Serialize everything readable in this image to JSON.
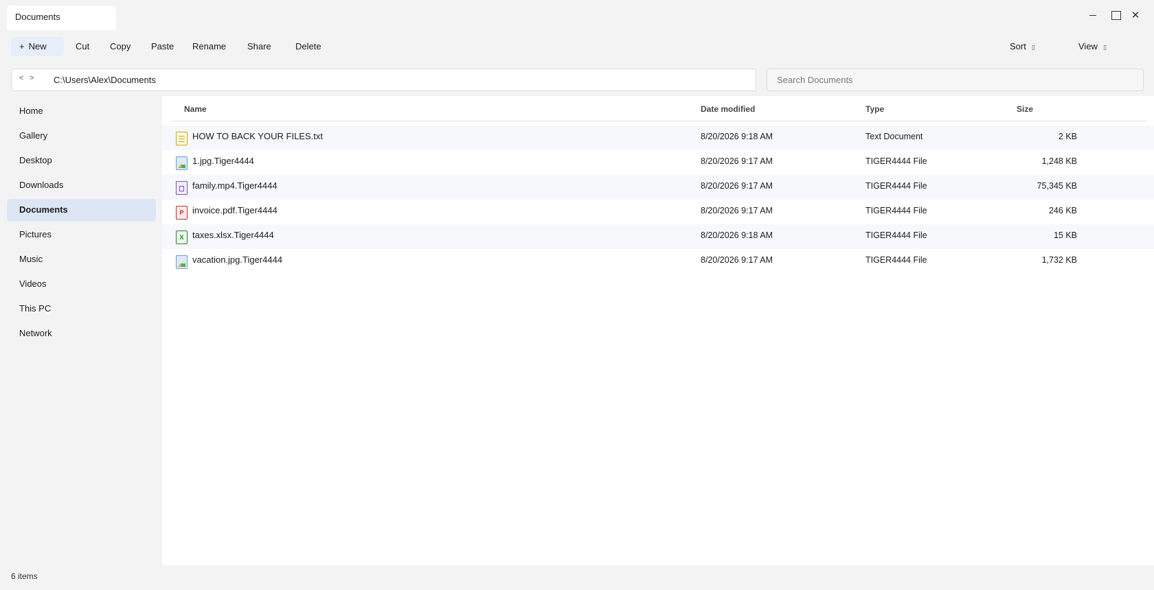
{
  "window": {
    "tab_title": "Documents",
    "controls": [
      "minimize-icon",
      "maximize-icon",
      "close-icon"
    ],
    "close_glyph": "✕"
  },
  "toolbar": {
    "new_plus": "+",
    "new_label": "New",
    "cut_label": "Cut",
    "copy_label": "Copy",
    "paste_label": "Paste",
    "rename_label": "Rename",
    "share_label": "Share",
    "delete_label": "Delete",
    "sort_label": "Sort",
    "view_label": "View",
    "chevron_glyph": "▯"
  },
  "address": {
    "back_glyph": "<",
    "forward_glyph": ">",
    "path": "C:\\Users\\Alex\\Documents"
  },
  "search": {
    "placeholder": "Search Documents",
    "value": ""
  },
  "sidebar": {
    "items": [
      {
        "label": "Home",
        "active": false
      },
      {
        "label": "Gallery",
        "active": false
      },
      {
        "label": "Desktop",
        "active": false
      },
      {
        "label": "Downloads",
        "active": false
      },
      {
        "label": "Documents",
        "active": true
      },
      {
        "label": "Pictures",
        "active": false
      },
      {
        "label": "Music",
        "active": false
      },
      {
        "label": "Videos",
        "active": false
      },
      {
        "label": "This PC",
        "active": false
      },
      {
        "label": "Network",
        "active": false
      }
    ]
  },
  "columns": {
    "name": "Name",
    "date": "Date modified",
    "type": "Type",
    "size": "Size"
  },
  "files": [
    {
      "icon": "text-file-icon",
      "name": "HOW TO BACK YOUR FILES.txt",
      "date": "8/20/2026 9:18 AM",
      "type": "Text Document",
      "size": "2 KB"
    },
    {
      "icon": "image-file-icon",
      "name": "1.jpg.Tiger4444",
      "date": "8/20/2026 9:17 AM",
      "type": "TIGER4444 File",
      "size": "1,248 KB"
    },
    {
      "icon": "video-file-icon",
      "name": "family.mp4.Tiger4444",
      "date": "8/20/2026 9:17 AM",
      "type": "TIGER4444 File",
      "size": "75,345 KB"
    },
    {
      "icon": "pdf-file-icon",
      "icon_letter": "P",
      "name": "invoice.pdf.Tiger4444",
      "date": "8/20/2026 9:17 AM",
      "type": "TIGER4444 File",
      "size": "246 KB"
    },
    {
      "icon": "excel-file-icon",
      "icon_letter": "X",
      "name": "taxes.xlsx.Tiger4444",
      "date": "8/20/2026 9:18 AM",
      "type": "TIGER4444 File",
      "size": "15 KB"
    },
    {
      "icon": "image-file-icon",
      "name": "vacation.jpg.Tiger4444",
      "date": "8/20/2026 9:17 AM",
      "type": "TIGER4444 File",
      "size": "1,732 KB"
    }
  ],
  "status": {
    "item_count": "6 items"
  },
  "colors": {
    "accent_selected": "#dce6f4",
    "new_button_bg": "#e6eef9",
    "window_bg": "#f3f3f3"
  }
}
